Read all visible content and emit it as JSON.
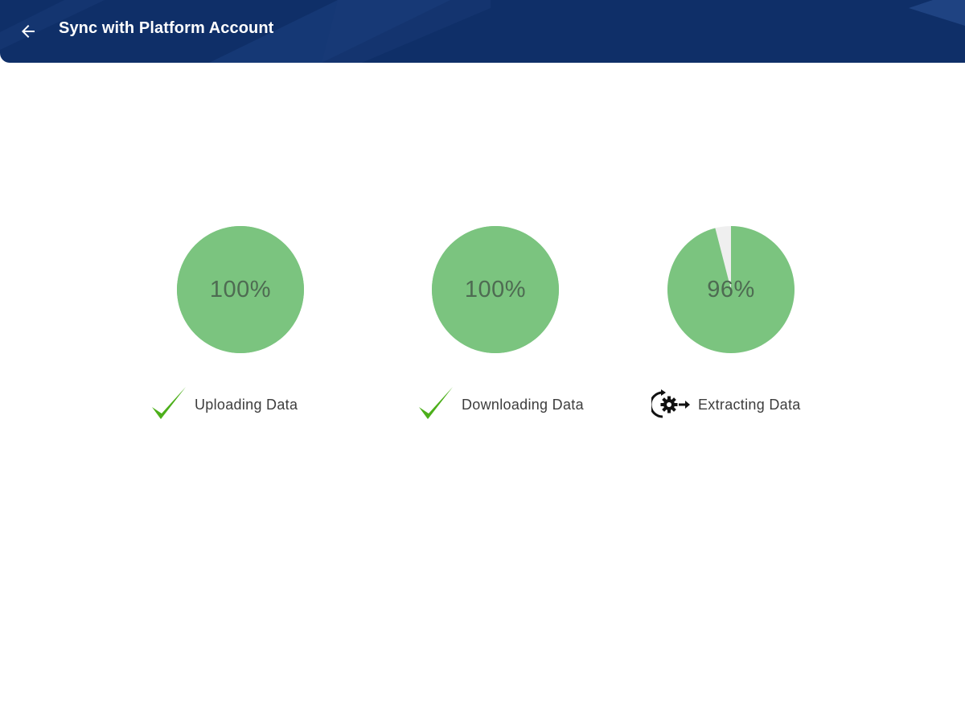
{
  "header": {
    "title": "Sync with Platform Account",
    "back_icon": "arrow-left-icon"
  },
  "colors": {
    "header_bg": "#0f2f68",
    "pie_fill": "#7bc47f",
    "pie_track": "#efefef",
    "check": "#4caf1a",
    "percent_text": "#4e6b52"
  },
  "steps": [
    {
      "label": "Uploading Data",
      "percent_label": "100%",
      "progress": 1.0,
      "status_icon": "checkmark-icon"
    },
    {
      "label": "Downloading Data",
      "percent_label": "100%",
      "progress": 1.0,
      "status_icon": "checkmark-icon"
    },
    {
      "label": "Extracting Data",
      "percent_label": "96%",
      "progress": 0.96,
      "status_icon": "gear-process-icon"
    }
  ]
}
